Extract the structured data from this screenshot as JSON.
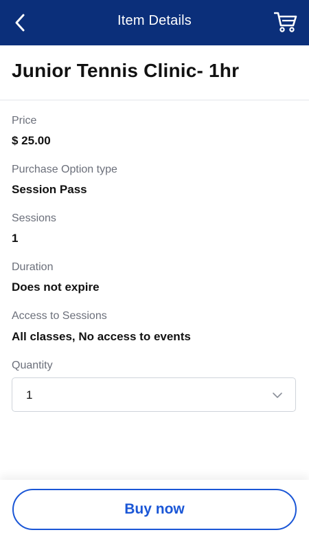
{
  "header": {
    "title": "Item Details",
    "back_icon": "chevron-left-icon",
    "cart_icon": "shopping-cart-icon",
    "background_color": "#0b2f7a"
  },
  "item": {
    "title": "Junior Tennis Clinic- 1hr"
  },
  "details": {
    "price": {
      "label": "Price",
      "value": "$ 25.00"
    },
    "purchase_option": {
      "label": "Purchase Option type",
      "value": "Session Pass"
    },
    "sessions": {
      "label": "Sessions",
      "value": "1"
    },
    "duration": {
      "label": "Duration",
      "value": "Does not expire"
    },
    "access": {
      "label": "Access to Sessions",
      "value": "All classes, No access to events"
    }
  },
  "quantity": {
    "label": "Quantity",
    "selected": "1",
    "icon": "chevron-down-icon"
  },
  "footer": {
    "buy_label": "Buy now",
    "accent_color": "#1a56d6"
  }
}
